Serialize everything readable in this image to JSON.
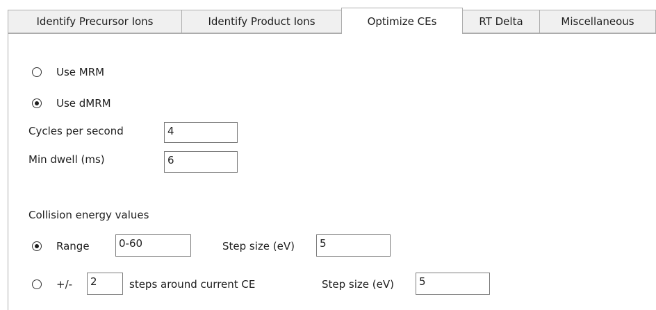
{
  "tabs": [
    {
      "label": "Identify Precursor Ions"
    },
    {
      "label": "Identify Product Ions"
    },
    {
      "label": "Optimize CEs"
    },
    {
      "label": "RT Delta"
    },
    {
      "label": "Miscellaneous"
    }
  ],
  "selected_tab": "Optimize CEs",
  "acquisition_mode": {
    "use_mrm_label": "Use MRM",
    "use_dmrm_label": "Use dMRM",
    "selected": "Use dMRM"
  },
  "cycles_per_second": {
    "label": "Cycles per second",
    "value": "4"
  },
  "min_dwell": {
    "label": "Min dwell (ms)",
    "value": "6"
  },
  "collision_energy": {
    "section_label": "Collision energy values",
    "selected": "Range",
    "range": {
      "label": "Range",
      "value": "0-60",
      "step_label": "Step size (eV)",
      "step_value": "5"
    },
    "steps_around": {
      "prefix_label": "+/-",
      "steps_value": "2",
      "suffix_label": "steps around current CE",
      "step_label": "Step size (eV)",
      "step_value": "5"
    }
  }
}
